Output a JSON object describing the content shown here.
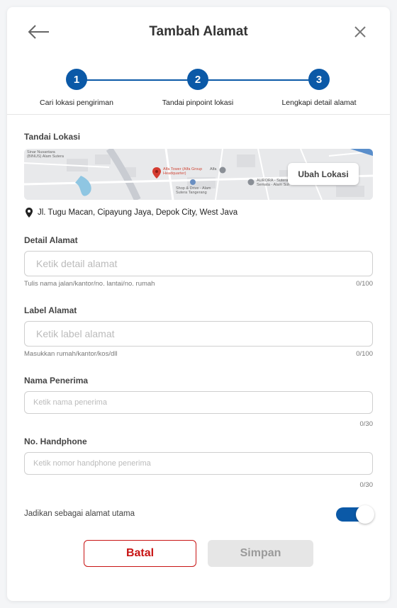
{
  "header": {
    "title": "Tambah Alamat",
    "back_icon": "arrow-left-icon",
    "close_icon": "close-icon"
  },
  "stepper": {
    "accent": "#0b59a7",
    "steps": [
      {
        "number": "1",
        "label": "Cari lokasi pengiriman"
      },
      {
        "number": "2",
        "label": "Tandai pinpoint lokasi"
      },
      {
        "number": "3",
        "label": "Lengkapi detail alamat"
      }
    ]
  },
  "location": {
    "label": "Tandai Lokasi",
    "change_button": "Ubah Lokasi",
    "address": "Jl. Tugu Macan, Cipayung Jaya, Depok City, West Java",
    "map_labels": {
      "top_left": "Sinar Nusantara (BINUS) Alam Sutera",
      "tower": "Alfa Tower (Alfa Group Headquarter)",
      "alfa": "Alfa",
      "shop": "Shop & Drive - Alam Sutera Tangerang",
      "aurora": "AURORA - Sutera Semata - Alam Sut"
    }
  },
  "detail_alamat": {
    "label": "Detail Alamat",
    "placeholder": "Ketik detail alamat",
    "value": "",
    "hint": "Tulis nama jalan/kantor/no. lantai/no. rumah",
    "counter": "0/100"
  },
  "label_alamat": {
    "label": "Label Alamat",
    "placeholder": "Ketik label alamat",
    "value": "",
    "hint": "Masukkan rumah/kantor/kos/dll",
    "counter": "0/100"
  },
  "nama_penerima": {
    "label": "Nama Penerima",
    "placeholder": "Ketik nama penerima",
    "value": "",
    "counter": "0/30"
  },
  "no_handphone": {
    "label": "No. Handphone",
    "placeholder": "Ketik nomor handphone penerima",
    "value": "",
    "counter": "0/30"
  },
  "main_address_toggle": {
    "label": "Jadikan sebagai alamat utama",
    "on": true
  },
  "actions": {
    "cancel": "Batal",
    "save": "Simpan"
  },
  "colors": {
    "primary": "#0b59a7",
    "danger": "#c81414",
    "disabled": "#e6e6e6"
  }
}
